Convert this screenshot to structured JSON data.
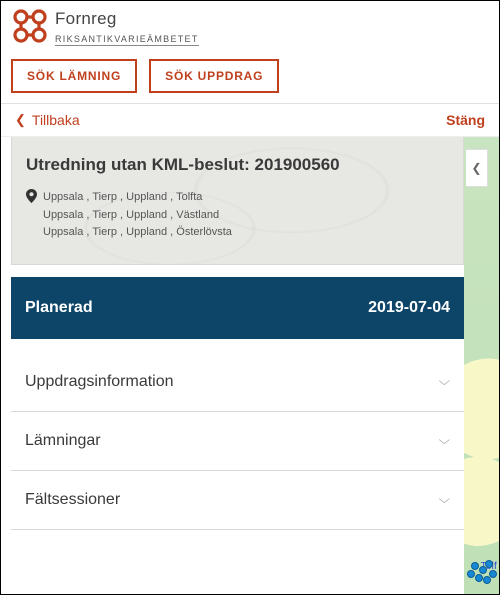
{
  "brand": {
    "title": "Fornreg",
    "subtitle": "RIKSANTIKVARIEÄMBETET"
  },
  "buttons": {
    "search_finding": "SÖK LÄMNING",
    "search_mission": "SÖK UPPDRAG"
  },
  "crumb": {
    "back": "Tillbaka",
    "close": "Stäng"
  },
  "detail": {
    "title": "Utredning utan KML-beslut: 201900560",
    "locations": [
      "Uppsala , Tierp , Uppland , Tolfta",
      "Uppsala , Tierp , Uppland , Västland",
      "Uppsala , Tierp , Uppland , Österlövsta"
    ]
  },
  "status": {
    "label": "Planerad",
    "date": "2019-07-04"
  },
  "sections": [
    {
      "label": "Uppdragsinformation"
    },
    {
      "label": "Lämningar"
    },
    {
      "label": "Fältsessioner"
    }
  ],
  "map": {
    "label_fragment": "Tolf"
  },
  "colors": {
    "accent": "#c0401e",
    "status_bg": "#0d4569"
  }
}
